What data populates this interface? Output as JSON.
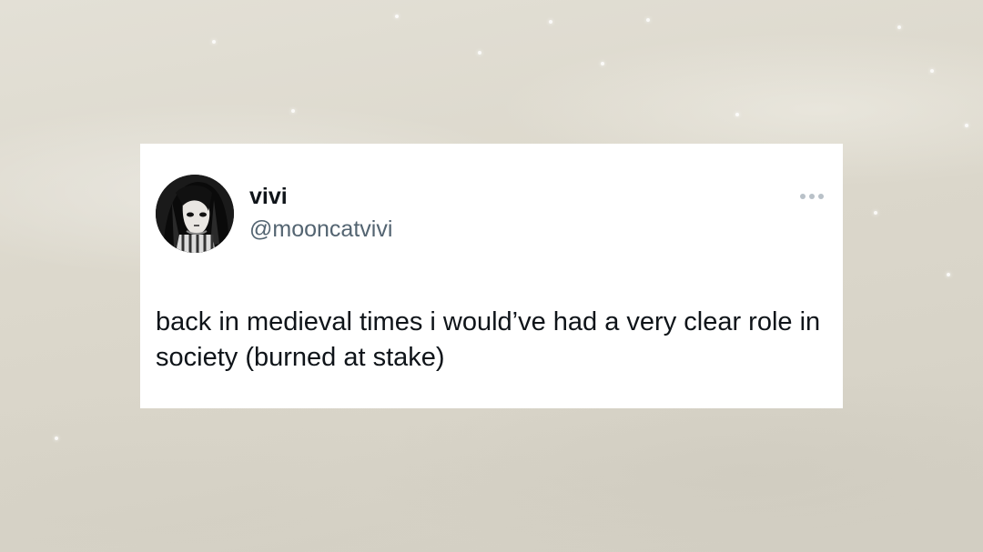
{
  "tweet": {
    "display_name": "vivi",
    "handle": "@mooncatvivi",
    "text": "back in medieval times i would’ve had a very clear role in society (burned at stake)",
    "more_icon": "more-horizontal-icon",
    "avatar": "profile-avatar"
  },
  "colors": {
    "card_background": "#ffffff",
    "name": "#0f1419",
    "handle": "#536471",
    "body_text": "#0f1419",
    "more_icon": "#b9c1c8"
  }
}
